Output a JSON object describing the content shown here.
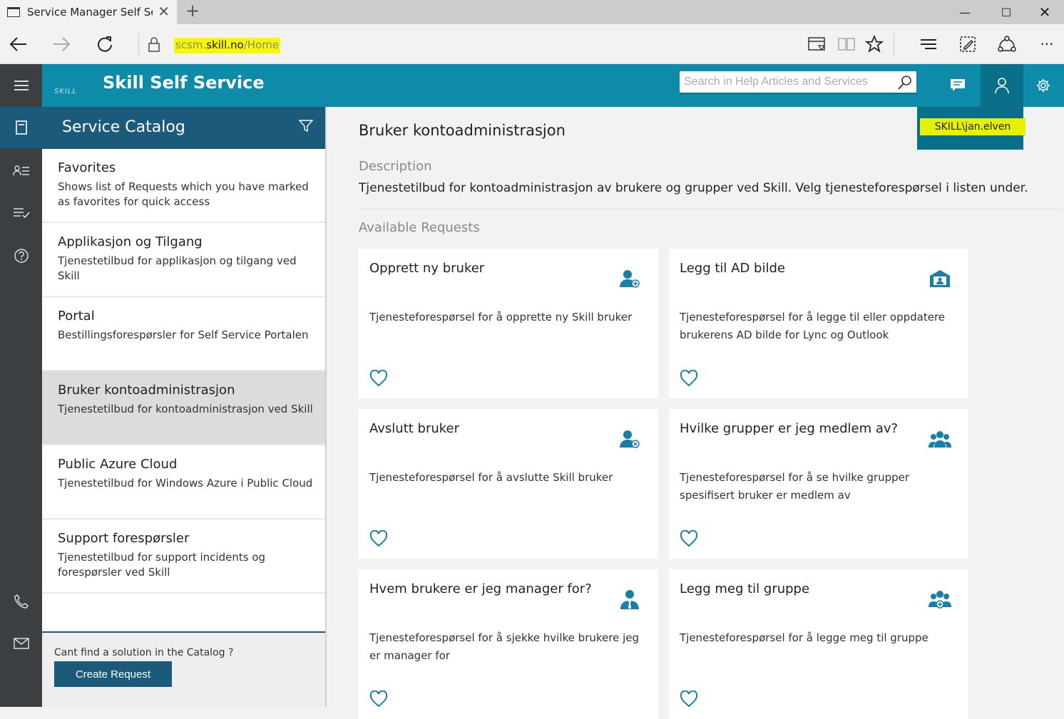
{
  "browser": {
    "tab_title": "Service Manager Self Se",
    "url_prefix": "scsm.",
    "url_host": "skill.no",
    "url_path": "/Home"
  },
  "header": {
    "logo_text": "SKILL",
    "app_title": "Skill Self Service",
    "search_placeholder": "Search in Help Articles and Services",
    "user_name": "SKILL\\jan.elven"
  },
  "catalog": {
    "title": "Service Catalog",
    "items": [
      {
        "name": "Favorites",
        "desc": "Shows list of Requests which you have marked as favorites for quick access"
      },
      {
        "name": "Applikasjon og Tilgang",
        "desc": "Tjenestetilbud for applikasjon og tilgang ved Skill"
      },
      {
        "name": "Portal",
        "desc": "Bestillingsforespørsler for Self Service Portalen"
      },
      {
        "name": "Bruker kontoadministrasjon",
        "desc": "Tjenestetilbud for kontoadministrasjon ved Skill"
      },
      {
        "name": "Public Azure Cloud",
        "desc": "Tjenestetilbud for Windows Azure i Public Cloud"
      },
      {
        "name": "Support forespørsler",
        "desc": "Tjenestetilbud for support incidents og forespørsler ved Skill"
      }
    ],
    "footer_text": "Cant find a solution in the Catalog ?",
    "create_button": "Create Request"
  },
  "main": {
    "title": "Bruker kontoadministrasjon",
    "description_label": "Description",
    "description": "Tjenestetilbud for kontoadministrasjon av brukere og grupper ved Skill. Velg tjenesteforespørsel i listen under.",
    "available_label": "Available Requests",
    "cards": [
      {
        "title": "Opprett ny bruker",
        "desc": "Tjenesteforespørsel for å opprette ny Skill bruker",
        "icon": "user-add-icon"
      },
      {
        "title": "Legg til AD bilde",
        "desc": "Tjenesteforespørsel for å legge til eller oppdatere brukerens AD bilde for Lync og Outlook",
        "icon": "id-card-icon"
      },
      {
        "title": "Avslutt bruker",
        "desc": "Tjenesteforespørsel for å avslutte Skill bruker",
        "icon": "user-remove-icon"
      },
      {
        "title": "Hvilke grupper er jeg medlem av?",
        "desc": "Tjenesteforespørsel for å se hvilke grupper spesifisert bruker er medlem av",
        "icon": "group-icon"
      },
      {
        "title": "Hvem brukere er jeg manager for?",
        "desc": "Tjenesteforespørsel for å sjekke hvilke brukere jeg er manager for",
        "icon": "manager-icon"
      },
      {
        "title": "Legg meg til gruppe",
        "desc": "Tjenesteforespørsel for å legge meg til gruppe",
        "icon": "group-add-icon"
      }
    ]
  },
  "colors": {
    "header": "#0e8ba8",
    "accent": "#1c5a7c",
    "icon": "#1a7fa8"
  }
}
